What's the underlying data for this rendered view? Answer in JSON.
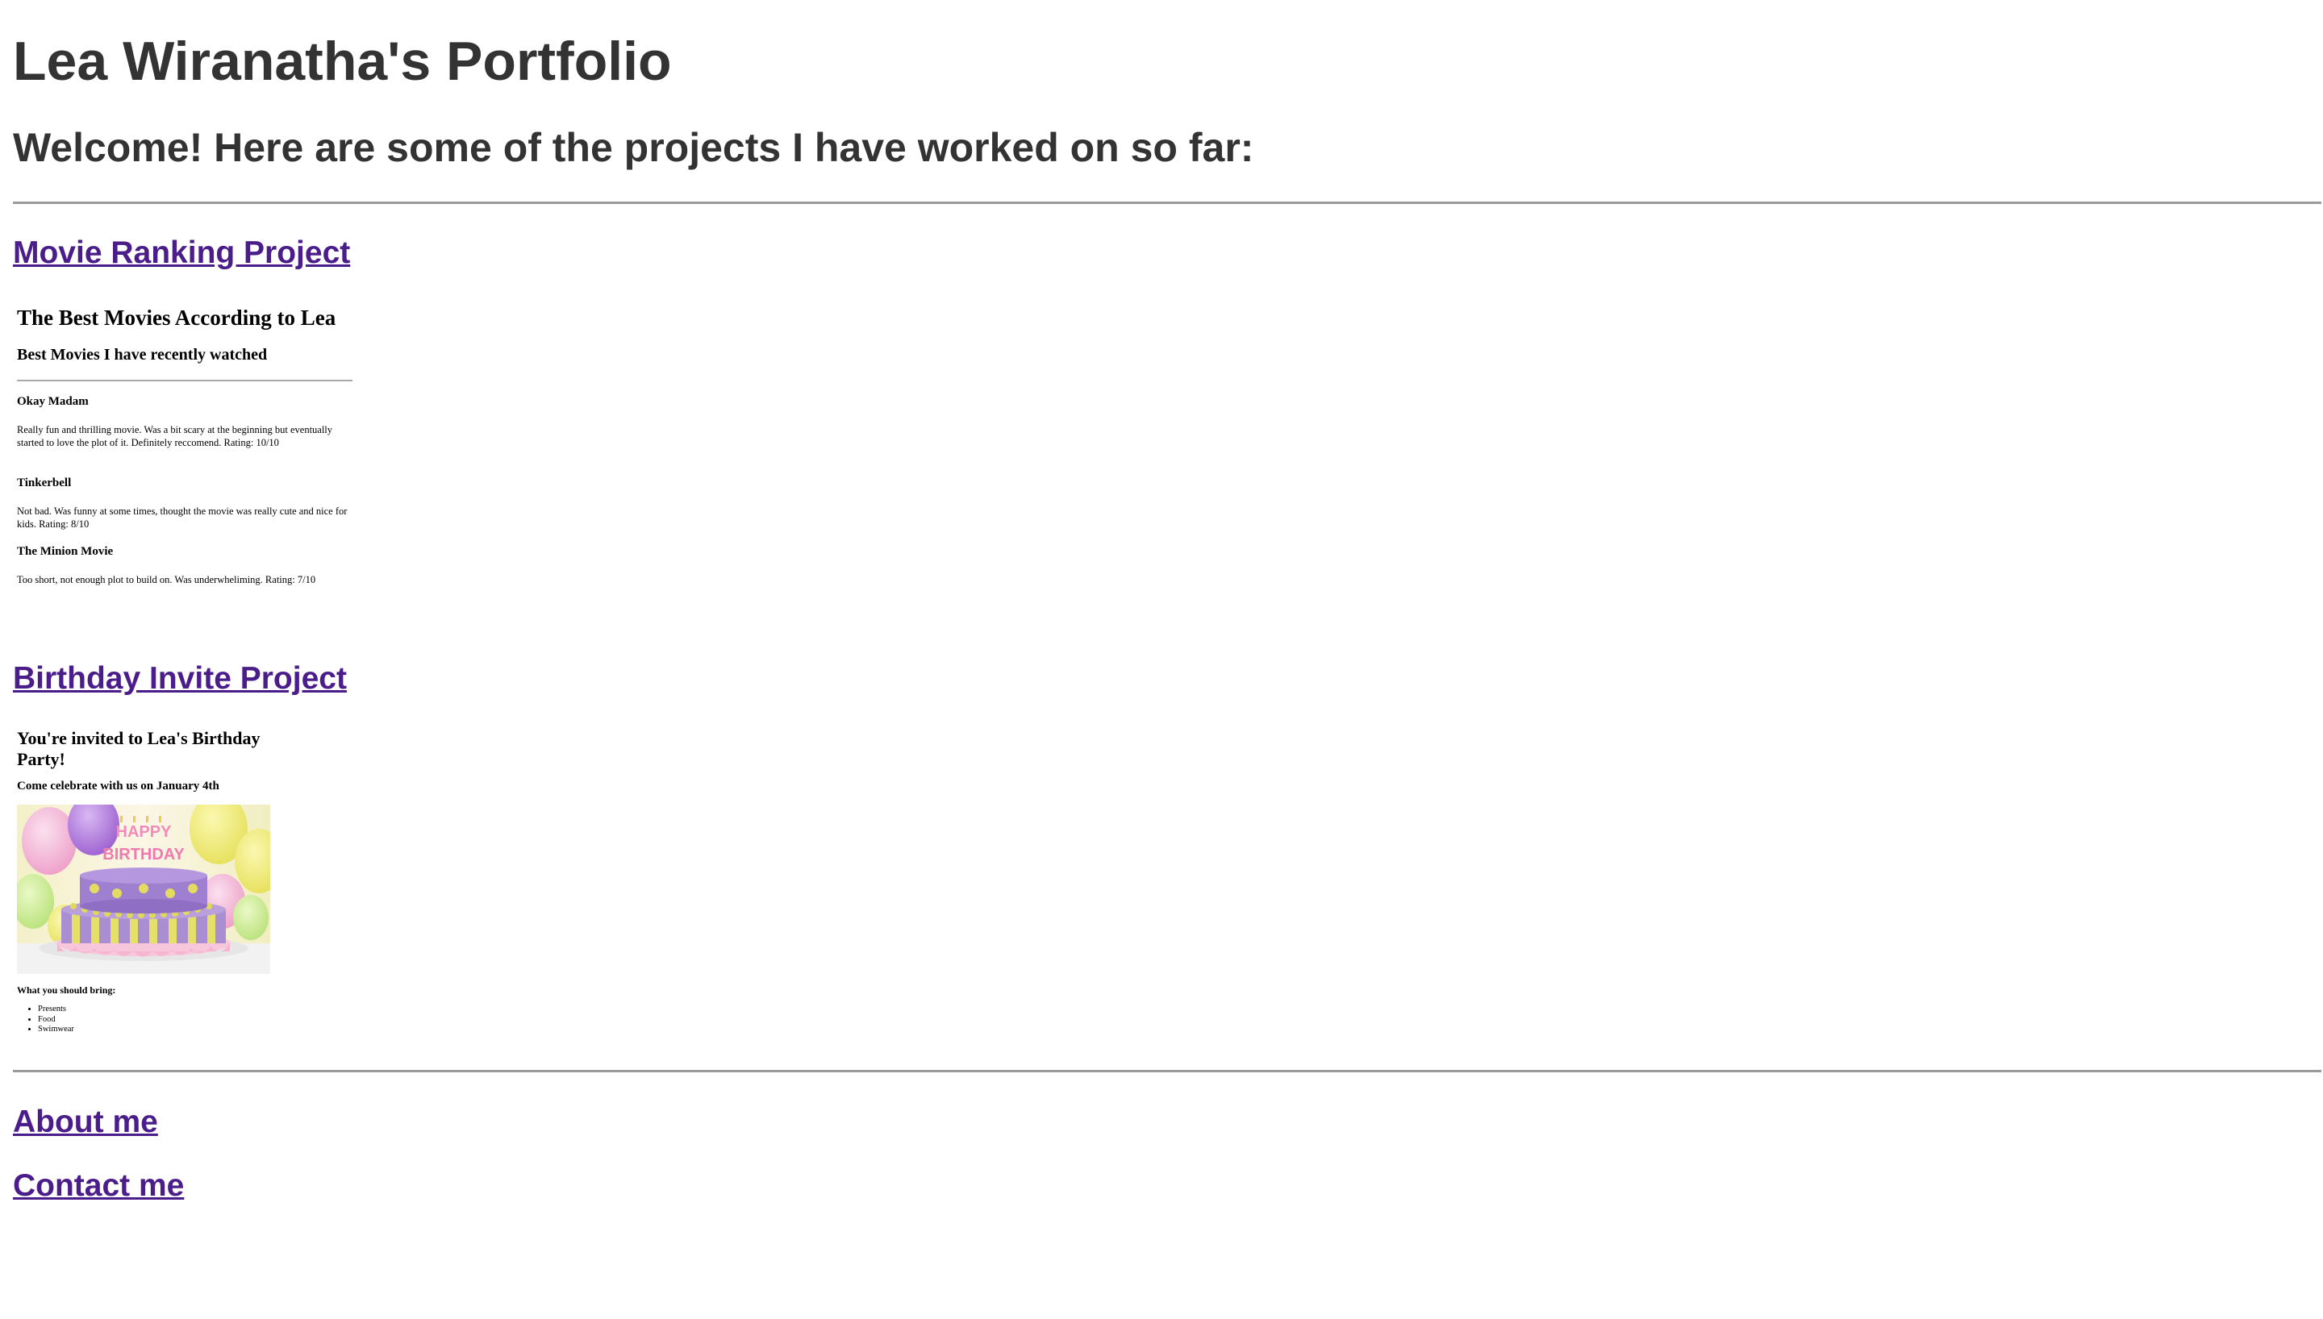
{
  "header": {
    "title": "Lea Wiranatha's Portfolio",
    "welcome": "Welcome! Here are some of the projects I have worked on so far:"
  },
  "projects": {
    "movie": {
      "link_label": "Movie Ranking Project",
      "preview": {
        "title": "The Best Movies According to Lea",
        "subtitle": "Best Movies I have recently watched",
        "movies": [
          {
            "name": "Okay Madam",
            "review": "Really fun and thrilling movie. Was a bit scary at the beginning but eventually started to love the plot of it. Definitely reccomend. Rating: 10/10"
          },
          {
            "name": "Tinkerbell",
            "review": "Not bad. Was funny at some times, thought the movie was really cute and nice for kids. Rating: 8/10"
          },
          {
            "name": "The Minion Movie",
            "review": "Too short, not enough plot to build on. Was underwheliming. Rating: 7/10"
          }
        ]
      }
    },
    "birthday": {
      "link_label": "Birthday Invite Project",
      "preview": {
        "title": "You're invited to Lea's Birthday Party!",
        "subtitle": "Come celebrate with us on January 4th",
        "cake_text": "HAPPY BIRTHDAY",
        "bring_label": "What you should bring:",
        "bring_items": [
          "Presents",
          "Food",
          "Swimwear"
        ]
      }
    }
  },
  "footer_links": {
    "about": "About me",
    "contact": "Contact me"
  },
  "colors": {
    "heading": "#333333",
    "link_visited": "#4b1d8a",
    "rule": "#9a9a9a"
  }
}
